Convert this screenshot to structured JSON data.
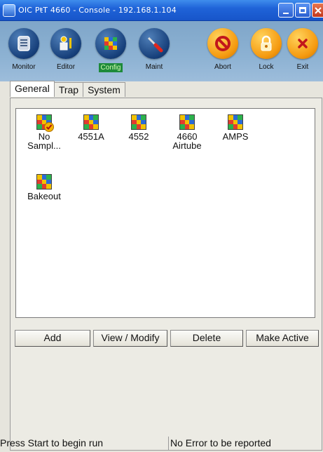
{
  "window": {
    "title": "OIC PŧT 4660 - Console - 192.168.1.104"
  },
  "toolbar": {
    "buttons": [
      {
        "label": "Monitor",
        "icon": "monitor-icon"
      },
      {
        "label": "Editor",
        "icon": "editor-icon"
      },
      {
        "label": "Config",
        "icon": "config-icon",
        "active": true
      },
      {
        "label": "Maint",
        "icon": "maint-icon"
      },
      {
        "label": "Abort",
        "icon": "abort-icon"
      },
      {
        "label": "Lock",
        "icon": "lock-icon"
      },
      {
        "label": "Exit",
        "icon": "exit-icon"
      }
    ]
  },
  "tabs": [
    {
      "label": "General",
      "selected": true
    },
    {
      "label": "Trap"
    },
    {
      "label": "System"
    }
  ],
  "configurations": [
    {
      "line1": "No",
      "line2": "Sampl...",
      "active": true
    },
    {
      "line1": "4551A",
      "line2": ""
    },
    {
      "line1": "4552",
      "line2": ""
    },
    {
      "line1": "4660",
      "line2": "Airtube"
    },
    {
      "line1": "AMPS",
      "line2": ""
    },
    {
      "line1": "Bakeout",
      "line2": ""
    }
  ],
  "actions": {
    "add": "Add",
    "view_modify": "View / Modify",
    "delete": "Delete",
    "make_active": "Make Active"
  },
  "status": {
    "left": "Press Start to begin run",
    "right": "No Error to be reported"
  },
  "colors": {
    "title_bar": "#1f63d8",
    "toolbar_bg": "#8db2d3",
    "active_tab_highlight": "#1e8a3a"
  }
}
